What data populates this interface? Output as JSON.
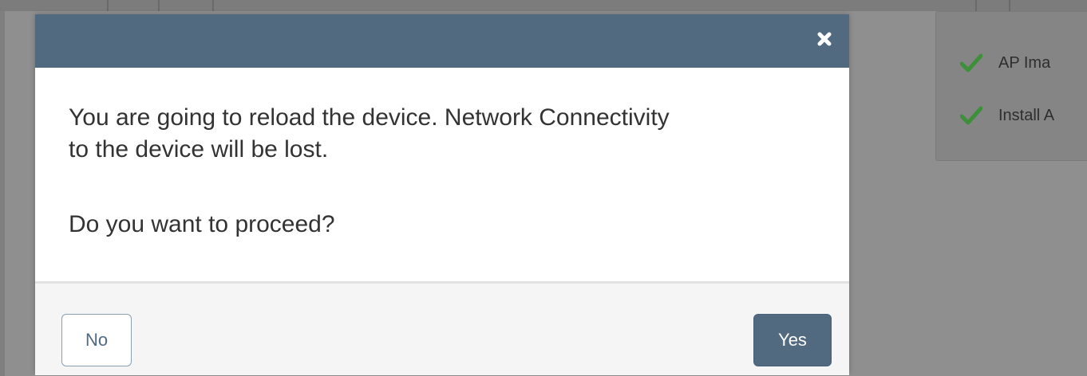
{
  "background": {
    "status_items": [
      {
        "label": "AP Ima",
        "icon": "check-icon",
        "color": "#2e7d32"
      },
      {
        "label": "Install A",
        "icon": "check-icon",
        "color": "#2e7d32"
      }
    ]
  },
  "modal": {
    "header_color": "#526a80",
    "close_icon": "close-icon",
    "message_line1": "You are going to reload the device. Network Connectivity",
    "message_line2": "to the device will be lost.",
    "question": "Do you want to proceed?",
    "no_label": "No",
    "yes_label": "Yes"
  }
}
